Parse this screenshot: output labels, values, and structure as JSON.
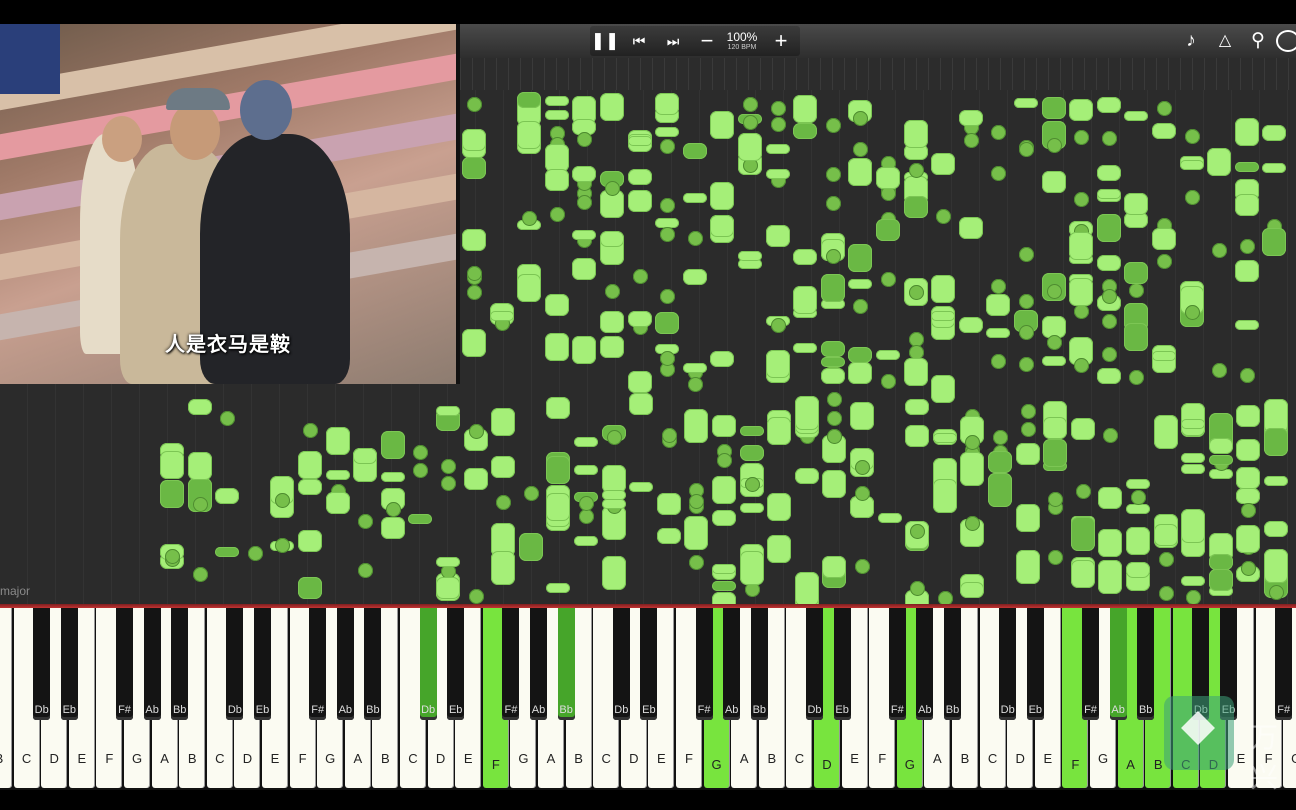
{
  "video": {
    "subtitle": "人是衣马是鞍"
  },
  "toolbar": {
    "pause_icon": "pause-icon",
    "prev_icon": "skip-back-icon",
    "next_icon": "skip-forward-icon",
    "tempo_down_icon": "minus-icon",
    "tempo_up_icon": "plus-icon",
    "tempo_percent": "100%",
    "tempo_bpm": "120 BPM",
    "right_tools": [
      "note-icon",
      "metronome-icon",
      "zoom-icon",
      "loop-icon"
    ]
  },
  "roll": {
    "key_signature_label": "major"
  },
  "colors": {
    "note": "#a5ef78",
    "note_dark": "#6ab844",
    "active_key": "#78e43e",
    "accent_line": "#c23232"
  },
  "keyboard": {
    "white_keys": [
      "B",
      "C",
      "D",
      "E",
      "F",
      "G",
      "A",
      "B",
      "C",
      "D",
      "E",
      "F",
      "G",
      "A",
      "B",
      "C",
      "D",
      "E",
      "F",
      "G",
      "A",
      "B",
      "C",
      "D",
      "E",
      "F",
      "G",
      "A",
      "B",
      "C",
      "D",
      "E",
      "F",
      "G",
      "A",
      "B",
      "C",
      "D",
      "E",
      "F",
      "G",
      "A",
      "B",
      "C",
      "D",
      "E",
      "F",
      "G"
    ],
    "white_active": [
      18,
      26,
      30,
      33,
      39,
      41,
      42,
      43,
      44
    ],
    "black_keys": [
      "Bb",
      "Db",
      "Eb",
      "F#",
      "Ab",
      "Bb",
      "Db",
      "Eb",
      "F#",
      "Ab",
      "Bb",
      "Db",
      "Eb",
      "F#",
      "Ab",
      "Bb",
      "Db",
      "Eb",
      "F#",
      "Ab",
      "Bb",
      "Db",
      "Eb",
      "F#",
      "Ab",
      "Bb",
      "Db",
      "Eb",
      "F#",
      "Ab",
      "Bb",
      "Db",
      "Eb",
      "F#",
      "Ab",
      "Bb",
      "Db",
      "Eb"
    ],
    "black_active": [
      11,
      15,
      29,
      35
    ]
  },
  "watermark": "万兴"
}
